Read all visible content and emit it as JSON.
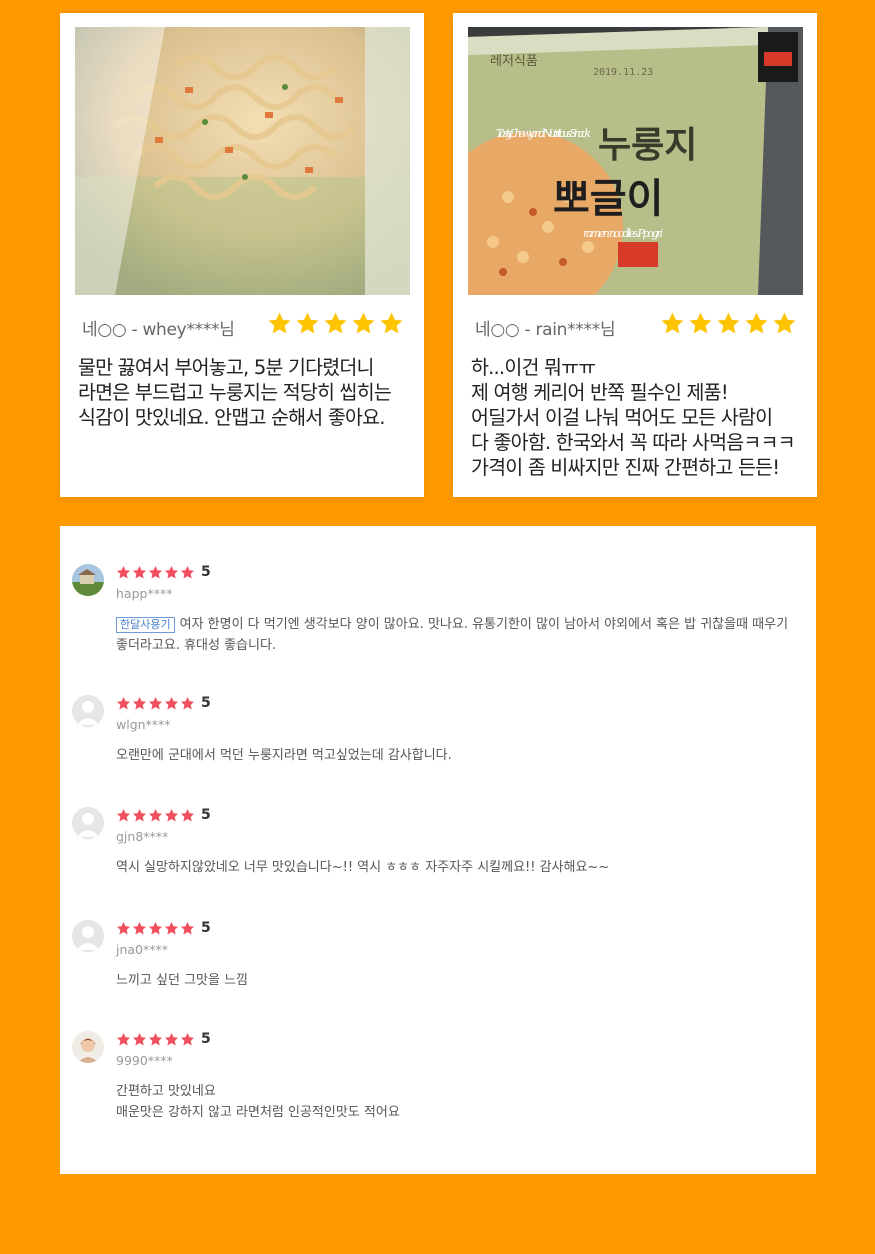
{
  "colors": {
    "background": "#FF9900",
    "star_gold": "#FFC400",
    "star_red": "#F25061"
  },
  "cards": [
    {
      "photo_icon": "ramen-cup-photo",
      "reviewer": "네○○ - whey****님",
      "rating": 5,
      "text": "물만 끓여서 부어놓고, 5분 기다렸더니\n라면은 부드럽고 누룽지는 적당히 씹히는\n식감이 맛있네요. 안맵고 순해서 좋아요."
    },
    {
      "photo_icon": "product-package-photo",
      "package_texts": [
        "레저식품",
        "2019.11.23",
        "Tasty, Chewy, and Nutritious Snack",
        "누룽지",
        "뽀글이",
        "ramen noodles Ppogri"
      ],
      "reviewer": "네○○ - rain****님",
      "rating": 5,
      "text": "하...이건 뭐ㅠㅠ\n제 여행 케리어 반쪽 필수인 제품!\n어딜가서 이걸 나눠 먹어도 모든 사람이\n다 좋아함. 한국와서 꼭 따라 사먹음ㅋㅋㅋ\n가격이 좀 비싸지만 진짜 간편하고 든든!"
    }
  ],
  "reviews": [
    {
      "avatar": "landscape-avatar",
      "rating": 5,
      "score": "5",
      "user": "happ****",
      "tag": "한달사용기",
      "text": "여자 한명이 다 먹기엔 생각보다 양이 많아요. 맛나요. 유통기한이 많이 남아서 야외에서 혹은 밥 귀찮을때 때우기 좋더라고요. 휴대성 좋습니다."
    },
    {
      "avatar": "default-user-avatar",
      "rating": 5,
      "score": "5",
      "user": "wlgn****",
      "text": "오랜만에 군대에서 먹던 누룽지라면 먹고싶었는데 감사합니다."
    },
    {
      "avatar": "default-user-avatar",
      "rating": 5,
      "score": "5",
      "user": "gjn8****",
      "text": "역시 실망하지않았네오 너무 맛있습니다~!! 역시 ㅎㅎㅎ 자주자주 시킬께요!! 감사해요~~"
    },
    {
      "avatar": "default-user-avatar",
      "rating": 5,
      "score": "5",
      "user": "jna0****",
      "text": "느끼고 싶던 그맛을 느낌"
    },
    {
      "avatar": "person-photo-avatar",
      "rating": 5,
      "score": "5",
      "user": "9990****",
      "text": "간편하고 맛있네요\n매운맛은 강하지 않고 라면처럼 인공적인맛도 적어요"
    }
  ]
}
